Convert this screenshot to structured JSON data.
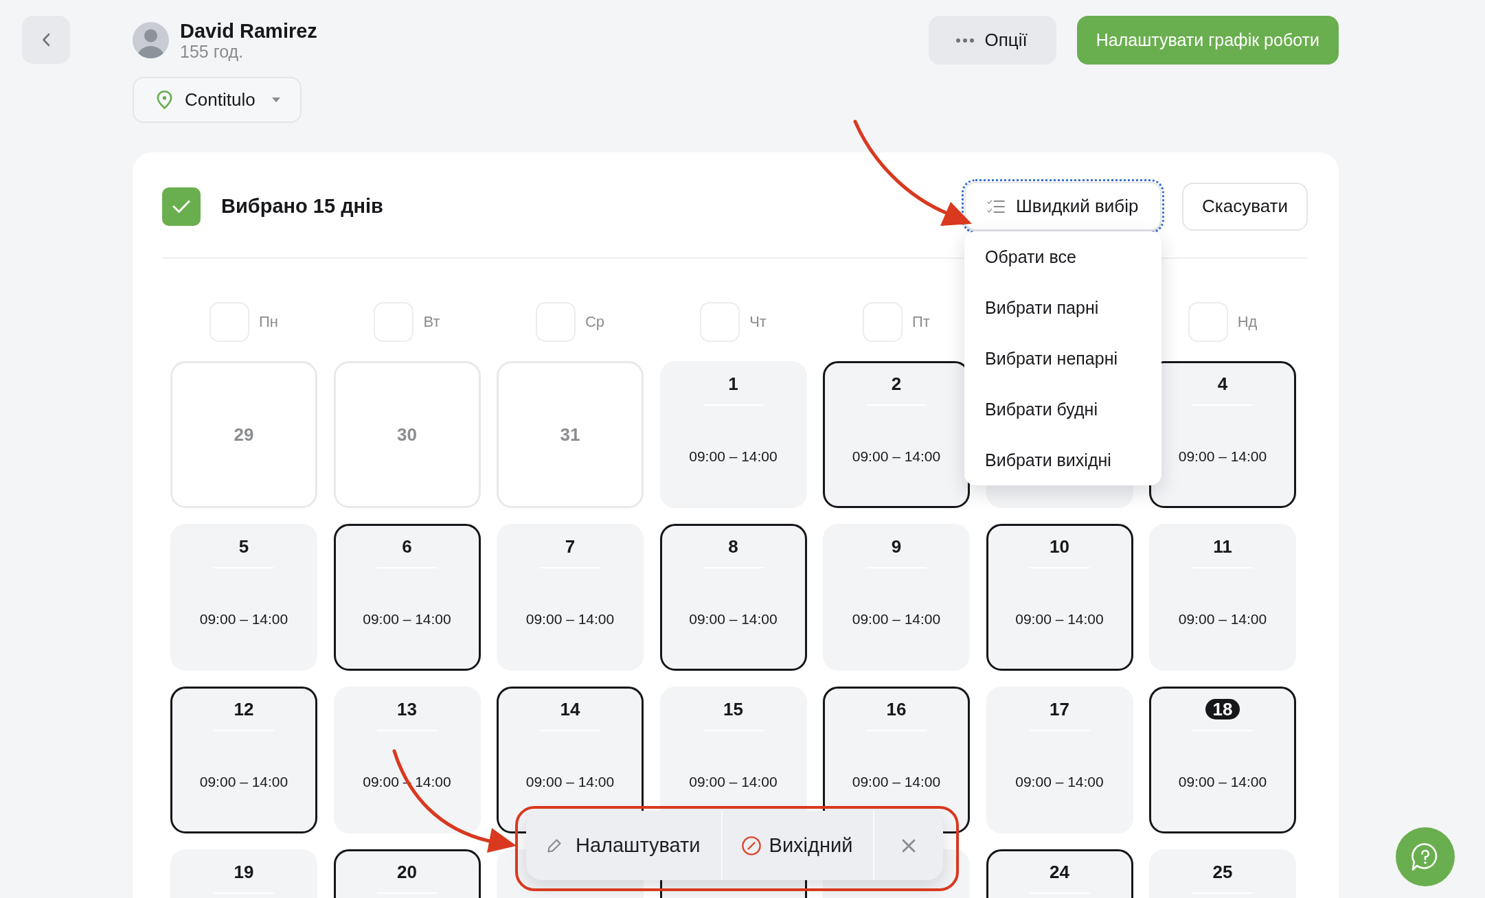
{
  "profile": {
    "name": "David Ramirez",
    "hours": "155 год."
  },
  "location": {
    "label": "Contitulo"
  },
  "header_actions": [
    {
      "kind": "options",
      "label": "Опції"
    },
    {
      "kind": "primary",
      "label": "Налаштувати графік роботи"
    }
  ],
  "selection": {
    "checked": true,
    "title": "Вибрано 15 днів"
  },
  "quick_select": {
    "label": "Швидкий вибір",
    "focused": true,
    "expanded": true,
    "menu": [
      "Обрати все",
      "Вибрати парні",
      "Вибрати непарні",
      "Вибрати будні",
      "Вибрати вихідні"
    ]
  },
  "cancel_button": {
    "label": "Скасувати"
  },
  "weekdays": [
    {
      "label": "Пн",
      "checked": false
    },
    {
      "label": "Вт",
      "checked": false
    },
    {
      "label": "Ср",
      "checked": false
    },
    {
      "label": "Чт",
      "checked": false
    },
    {
      "label": "Пт",
      "checked": false
    },
    {
      "label": "Нд",
      "checked": false
    }
  ],
  "days": [
    {
      "kind": "outside",
      "day": "29",
      "selected": false
    },
    {
      "kind": "outside",
      "day": "30",
      "selected": false
    },
    {
      "kind": "outside",
      "day": "31",
      "selected": false
    },
    {
      "kind": "current",
      "day": "1",
      "time": "09:00 – 14:00",
      "selected": false,
      "today": false
    },
    {
      "kind": "current",
      "day": "2",
      "time": "09:00 – 14:00",
      "selected": true,
      "today": false
    },
    {
      "kind": "current",
      "selected": false
    },
    {
      "kind": "current",
      "day": "4",
      "time": "09:00 – 14:00",
      "selected": true,
      "today": false
    },
    {
      "kind": "current",
      "day": "5",
      "time": "09:00 – 14:00",
      "selected": false,
      "today": false
    },
    {
      "kind": "current",
      "day": "6",
      "time": "09:00 – 14:00",
      "selected": true,
      "today": false
    },
    {
      "kind": "current",
      "day": "7",
      "time": "09:00 – 14:00",
      "selected": false,
      "today": false
    },
    {
      "kind": "current",
      "day": "8",
      "time": "09:00 – 14:00",
      "selected": true,
      "today": false
    },
    {
      "kind": "current",
      "day": "9",
      "time": "09:00 – 14:00",
      "selected": false,
      "today": false
    },
    {
      "kind": "current",
      "day": "10",
      "time": "09:00 – 14:00",
      "selected": true,
      "today": false
    },
    {
      "kind": "current",
      "day": "11",
      "time": "09:00 – 14:00",
      "selected": false,
      "today": false
    },
    {
      "kind": "current",
      "day": "12",
      "time": "09:00 – 14:00",
      "selected": true,
      "today": false
    },
    {
      "kind": "current",
      "day": "13",
      "time": "09:00 – 14:00",
      "selected": false,
      "today": false
    },
    {
      "kind": "current",
      "day": "14",
      "time": "09:00 – 14:00",
      "selected": true,
      "today": false
    },
    {
      "kind": "current",
      "day": "15",
      "time": "09:00 – 14:00",
      "selected": false,
      "today": false
    },
    {
      "kind": "current",
      "day": "16",
      "time": "09:00 – 14:00",
      "selected": true,
      "today": false
    },
    {
      "kind": "current",
      "day": "17",
      "time": "09:00 – 14:00",
      "selected": false,
      "today": false
    },
    {
      "kind": "current",
      "day": "18",
      "time": "09:00 – 14:00",
      "selected": true,
      "today": true
    },
    {
      "kind": "current",
      "day": "19",
      "selected": false,
      "today": false
    },
    {
      "kind": "current",
      "day": "20",
      "selected": true,
      "today": false
    },
    {
      "kind": "current",
      "selected": false
    },
    {
      "kind": "current",
      "selected": true
    },
    {
      "kind": "current",
      "selected": false
    },
    {
      "kind": "current",
      "day": "24",
      "selected": true,
      "today": false
    },
    {
      "kind": "current",
      "day": "25",
      "selected": false,
      "today": false
    }
  ],
  "action_bar": {
    "items": [
      {
        "kind": "edit",
        "label": "Налаштувати"
      },
      {
        "kind": "day_off",
        "label": "Вихідний"
      },
      {
        "kind": "close"
      }
    ]
  }
}
